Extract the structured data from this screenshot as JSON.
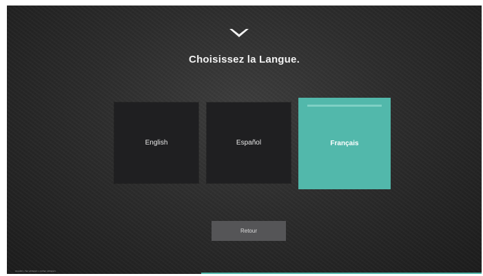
{
  "header": {
    "logo_icon": "vizio-v-logo-icon",
    "title": "Choisissez la Langue."
  },
  "languages": [
    {
      "label": "English",
      "selected": false
    },
    {
      "label": "Español",
      "selected": false
    },
    {
      "label": "Français",
      "selected": true
    }
  ],
  "back_button": {
    "label": "Retour"
  },
  "footer": {
    "info_text": "model • fw version • netw version"
  },
  "colors": {
    "accent": "#52b8ab",
    "tile_background": "#1f1f21",
    "button_background": "#555557",
    "text": "#f2f2f2"
  }
}
